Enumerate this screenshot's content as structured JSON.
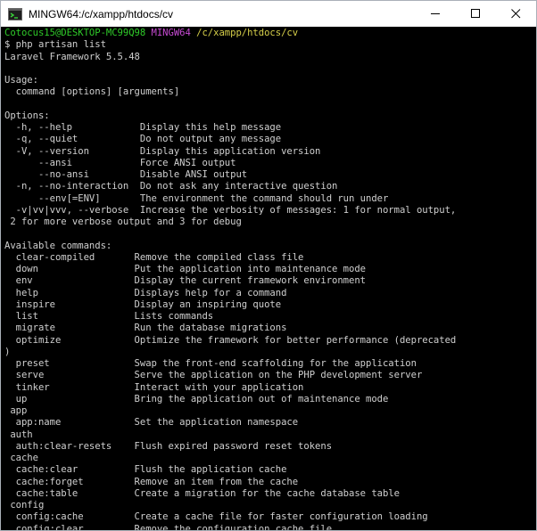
{
  "window": {
    "title": "MINGW64:/c/xampp/htdocs/cv",
    "minimize_label": "minimize",
    "maximize_label": "maximize",
    "close_label": "close"
  },
  "prompt": {
    "user_host": "Cotocus15@DESKTOP-MC99Q98",
    "env": "MINGW64",
    "path": "/c/xampp/htdocs/cv",
    "command": "$ php artisan list"
  },
  "output": {
    "version": "Laravel Framework 5.5.48",
    "usage_header": "Usage:",
    "usage_line": "  command [options] [arguments]",
    "options_header": "Options:",
    "options": [
      "  -h, --help            Display this help message",
      "  -q, --quiet           Do not output any message",
      "  -V, --version         Display this application version",
      "      --ansi            Force ANSI output",
      "      --no-ansi         Disable ANSI output",
      "  -n, --no-interaction  Do not ask any interactive question",
      "      --env[=ENV]       The environment the command should run under",
      "  -v|vv|vvv, --verbose  Increase the verbosity of messages: 1 for normal output,",
      " 2 for more verbose output and 3 for debug"
    ],
    "commands_header": "Available commands:",
    "commands": [
      "  clear-compiled       Remove the compiled class file",
      "  down                 Put the application into maintenance mode",
      "  env                  Display the current framework environment",
      "  help                 Displays help for a command",
      "  inspire              Display an inspiring quote",
      "  list                 Lists commands",
      "  migrate              Run the database migrations",
      "  optimize             Optimize the framework for better performance (deprecated",
      ")",
      "  preset               Swap the front-end scaffolding for the application",
      "  serve                Serve the application on the PHP development server",
      "  tinker               Interact with your application",
      "  up                   Bring the application out of maintenance mode",
      " app",
      "  app:name             Set the application namespace",
      " auth",
      "  auth:clear-resets    Flush expired password reset tokens",
      " cache",
      "  cache:clear          Flush the application cache",
      "  cache:forget         Remove an item from the cache",
      "  cache:table          Create a migration for the cache database table",
      " config",
      "  config:cache         Create a cache file for faster configuration loading",
      "  config:clear         Remove the configuration cache file"
    ]
  }
}
